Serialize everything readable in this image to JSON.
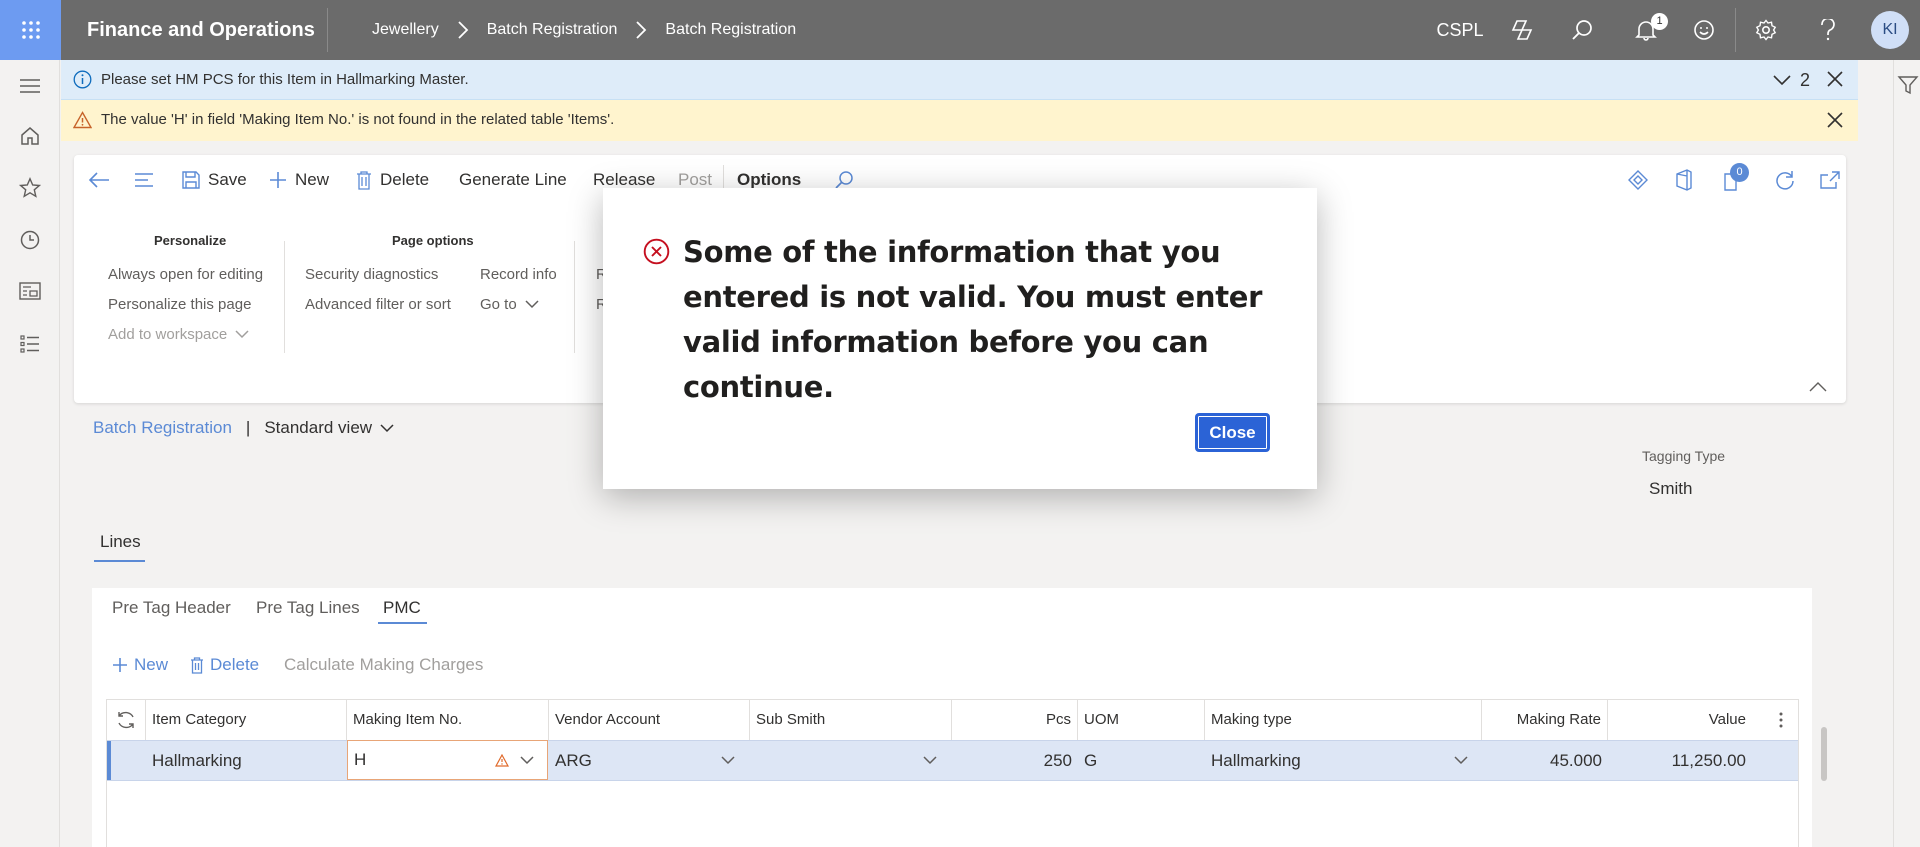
{
  "topbar": {
    "app_title": "Finance and Operations",
    "breadcrumbs": [
      "Jewellery",
      "Batch Registration",
      "Batch Registration"
    ],
    "company": "CSPL",
    "notification_count": "1",
    "avatar_initials": "KI"
  },
  "messages": {
    "info_text": "Please set HM PCS for this Item in Hallmarking Master.",
    "info_count": "2",
    "warning_text": "The value 'H' in field 'Making Item No.' is not found in the related table 'Items'."
  },
  "action_pane": {
    "save": "Save",
    "new": "New",
    "delete": "Delete",
    "generate_line": "Generate Line",
    "release": "Release",
    "post": "Post",
    "options": "Options",
    "badge_count": "0"
  },
  "options_groups": {
    "personalize_title": "Personalize",
    "always_open": "Always open for editing",
    "personalize_page": "Personalize this page",
    "add_to_workspace": "Add to workspace",
    "page_options_title": "Page options",
    "security_diagnostics": "Security diagnostics",
    "advanced_filter": "Advanced filter or sort",
    "record_info": "Record info",
    "go_to": "Go to",
    "r1": "R",
    "r2": "R"
  },
  "form": {
    "caption_link": "Batch Registration",
    "caption_sep": "|",
    "view_name": "Standard view",
    "tagging_type_label": "Tagging Type",
    "tagging_type_value": "Smith",
    "lines_tab": "Lines"
  },
  "lines": {
    "sub_tabs": [
      "Pre Tag Header",
      "Pre Tag Lines",
      "PMC"
    ],
    "toolbar": {
      "new": "New",
      "delete": "Delete",
      "calculate": "Calculate Making Charges"
    },
    "columns": [
      "Item Category",
      "Making Item No.",
      "Vendor Account",
      "Sub Smith",
      "Pcs",
      "UOM",
      "Making type",
      "Making Rate",
      "Value"
    ],
    "row": {
      "item_category": "Hallmarking",
      "making_item_no": "H",
      "vendor_account": "ARG",
      "sub_smith": "",
      "pcs": "250",
      "uom": "G",
      "making_type": "Hallmarking",
      "making_rate": "45.000",
      "value": "11,250.00"
    }
  },
  "dialog": {
    "message": "Some of the information that you entered is not valid. You must enter valid information before you can continue.",
    "close_label": "Close"
  },
  "colors": {
    "topbar": "#6b6b6b",
    "waffle": "#6d9bf1",
    "accent": "#5b8ad5",
    "info_bar": "#deecf9",
    "warning_bar": "#fff4ce",
    "error_icon": "#c50f1f",
    "button": "#2b63d6"
  },
  "icons": [
    "waffle-icon",
    "copilot-icon",
    "search-icon",
    "bell-icon",
    "smiley-icon",
    "gear-icon",
    "help-icon",
    "hamburger-icon",
    "home-icon",
    "star-icon",
    "clock-icon",
    "workspace-icon",
    "list-icon",
    "filter-icon",
    "info-icon",
    "warning-icon",
    "close-icon",
    "error-icon"
  ]
}
